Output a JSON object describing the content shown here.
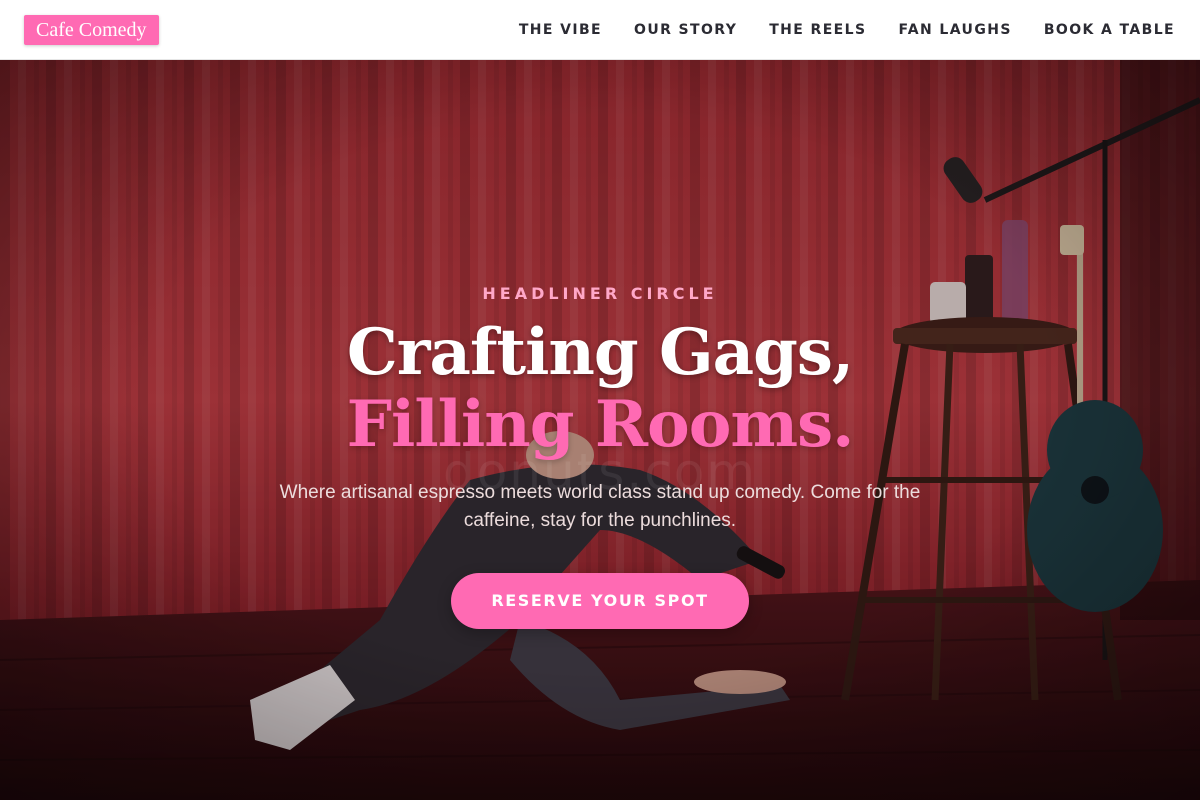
{
  "brand": {
    "logo_text": "Cafe Comedy",
    "accent_color": "#ff6ab3"
  },
  "nav": {
    "items": [
      {
        "label": "THE VIBE"
      },
      {
        "label": "OUR STORY"
      },
      {
        "label": "THE REELS"
      },
      {
        "label": "FAN LAUGHS"
      },
      {
        "label": "BOOK A TABLE"
      }
    ]
  },
  "hero": {
    "eyebrow": "HEADLINER CIRCLE",
    "title_line1": "Crafting Gags,",
    "title_line2": "Filling Rooms.",
    "subtitle": "Where artisanal espresso meets world class stand up comedy. Come for the caffeine, stay for the punchlines.",
    "cta_label": "RESERVE YOUR SPOT",
    "background_image": "comedian-on-stage-photo",
    "watermark": "donuts.com"
  }
}
